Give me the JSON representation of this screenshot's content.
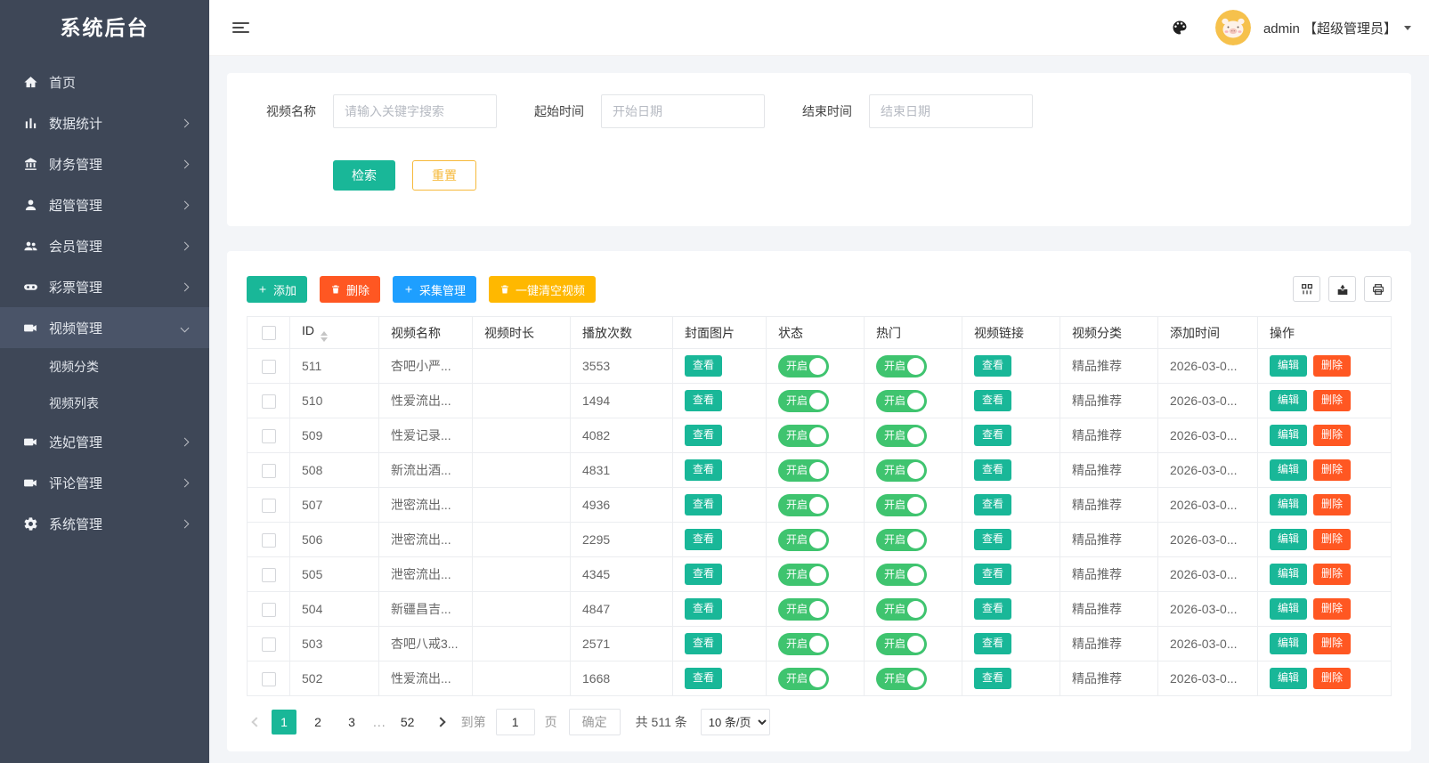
{
  "colors": {
    "accent_teal": "#19b798",
    "danger_red": "#ff5722",
    "primary_blue": "#1e9fff",
    "warning_yellow": "#ffb800",
    "toggle_green": "#3fc46f",
    "reset_orange": "#f6b93b",
    "sidebar_bg": "#3e4757",
    "avatar_bg": "#f6c14c"
  },
  "sidebar": {
    "title": "系统后台",
    "items": [
      {
        "key": "home",
        "label": "首页",
        "icon": "home-icon"
      },
      {
        "key": "stats",
        "label": "数据统计",
        "icon": "chart-icon",
        "arrow": "right"
      },
      {
        "key": "finance",
        "label": "财务管理",
        "icon": "bank-icon",
        "arrow": "right"
      },
      {
        "key": "superadmin",
        "label": "超管管理",
        "icon": "user-icon",
        "arrow": "right"
      },
      {
        "key": "members",
        "label": "会员管理",
        "icon": "users-icon",
        "arrow": "right"
      },
      {
        "key": "lottery",
        "label": "彩票管理",
        "icon": "lottery-icon",
        "arrow": "right"
      },
      {
        "key": "video",
        "label": "视频管理",
        "icon": "video-icon",
        "arrow": "down",
        "active": true,
        "children": [
          {
            "key": "video-category",
            "label": "视频分类"
          },
          {
            "key": "video-list",
            "label": "视频列表"
          }
        ]
      },
      {
        "key": "concubine",
        "label": "选妃管理",
        "icon": "video-icon",
        "arrow": "right"
      },
      {
        "key": "comments",
        "label": "评论管理",
        "icon": "video-icon",
        "arrow": "right"
      },
      {
        "key": "system",
        "label": "系统管理",
        "icon": "gear-icon",
        "arrow": "right"
      }
    ]
  },
  "header": {
    "admin_label": "admin 【超级管理员】",
    "icons": [
      "menu-toggle-icon",
      "palette-icon",
      "avatar",
      "dropdown-caret-icon"
    ]
  },
  "search": {
    "fields": [
      {
        "label": "视频名称",
        "placeholder": "请输入关键字搜索"
      },
      {
        "label": "起始时间",
        "placeholder": "开始日期"
      },
      {
        "label": "结束时间",
        "placeholder": "结束日期"
      }
    ],
    "search_label": "检索",
    "reset_label": "重置"
  },
  "toolbar": {
    "add_label": "添加",
    "delete_label": "删除",
    "collect_label": "采集管理",
    "clear_label": "一键清空视频",
    "icon_buttons": [
      "column-filter-icon",
      "export-icon",
      "print-icon"
    ]
  },
  "table": {
    "columns": [
      {
        "type": "checkbox",
        "label": ""
      },
      {
        "label": "ID",
        "sortable": true
      },
      {
        "label": "视频名称"
      },
      {
        "label": "视频时长"
      },
      {
        "label": "播放次数"
      },
      {
        "label": "封面图片"
      },
      {
        "label": "状态"
      },
      {
        "label": "热门"
      },
      {
        "label": "视频链接"
      },
      {
        "label": "视频分类"
      },
      {
        "label": "添加时间"
      },
      {
        "label": "操作"
      }
    ],
    "rows": [
      {
        "id": "511",
        "name": "杏吧小严...",
        "duration": "",
        "plays": "3553",
        "cover_label": "查看",
        "status_label": "开启",
        "hot_label": "开启",
        "link_label": "查看",
        "category": "精品推荐",
        "added_time": "2026-03-0...",
        "edit_label": "编辑",
        "delete_label": "删除"
      },
      {
        "id": "510",
        "name": "性爱流出...",
        "duration": "",
        "plays": "1494",
        "cover_label": "查看",
        "status_label": "开启",
        "hot_label": "开启",
        "link_label": "查看",
        "category": "精品推荐",
        "added_time": "2026-03-0...",
        "edit_label": "编辑",
        "delete_label": "删除"
      },
      {
        "id": "509",
        "name": "性爱记录...",
        "duration": "",
        "plays": "4082",
        "cover_label": "查看",
        "status_label": "开启",
        "hot_label": "开启",
        "link_label": "查看",
        "category": "精品推荐",
        "added_time": "2026-03-0...",
        "edit_label": "编辑",
        "delete_label": "删除"
      },
      {
        "id": "508",
        "name": "新流出酒...",
        "duration": "",
        "plays": "4831",
        "cover_label": "查看",
        "status_label": "开启",
        "hot_label": "开启",
        "link_label": "查看",
        "category": "精品推荐",
        "added_time": "2026-03-0...",
        "edit_label": "编辑",
        "delete_label": "删除"
      },
      {
        "id": "507",
        "name": "泄密流出...",
        "duration": "",
        "plays": "4936",
        "cover_label": "查看",
        "status_label": "开启",
        "hot_label": "开启",
        "link_label": "查看",
        "category": "精品推荐",
        "added_time": "2026-03-0...",
        "edit_label": "编辑",
        "delete_label": "删除"
      },
      {
        "id": "506",
        "name": "泄密流出...",
        "duration": "",
        "plays": "2295",
        "cover_label": "查看",
        "status_label": "开启",
        "hot_label": "开启",
        "link_label": "查看",
        "category": "精品推荐",
        "added_time": "2026-03-0...",
        "edit_label": "编辑",
        "delete_label": "删除"
      },
      {
        "id": "505",
        "name": "泄密流出...",
        "duration": "",
        "plays": "4345",
        "cover_label": "查看",
        "status_label": "开启",
        "hot_label": "开启",
        "link_label": "查看",
        "category": "精品推荐",
        "added_time": "2026-03-0...",
        "edit_label": "编辑",
        "delete_label": "删除"
      },
      {
        "id": "504",
        "name": "新疆昌吉...",
        "duration": "",
        "plays": "4847",
        "cover_label": "查看",
        "status_label": "开启",
        "hot_label": "开启",
        "link_label": "查看",
        "category": "精品推荐",
        "added_time": "2026-03-0...",
        "edit_label": "编辑",
        "delete_label": "删除"
      },
      {
        "id": "503",
        "name": "杏吧八戒3...",
        "duration": "",
        "plays": "2571",
        "cover_label": "查看",
        "status_label": "开启",
        "hot_label": "开启",
        "link_label": "查看",
        "category": "精品推荐",
        "added_time": "2026-03-0...",
        "edit_label": "编辑",
        "delete_label": "删除"
      },
      {
        "id": "502",
        "name": "性爱流出...",
        "duration": "",
        "plays": "1668",
        "cover_label": "查看",
        "status_label": "开启",
        "hot_label": "开启",
        "link_label": "查看",
        "category": "精品推荐",
        "added_time": "2026-03-0...",
        "edit_label": "编辑",
        "delete_label": "删除"
      }
    ]
  },
  "pagination": {
    "pages": [
      "1",
      "2",
      "3",
      "...",
      "52"
    ],
    "active_page": "1",
    "jump_prefix": "到第",
    "jump_value": "1",
    "jump_suffix": "页",
    "confirm_label": "确定",
    "total_label": "共 511 条",
    "per_page_options": [
      "10 条/页"
    ]
  }
}
